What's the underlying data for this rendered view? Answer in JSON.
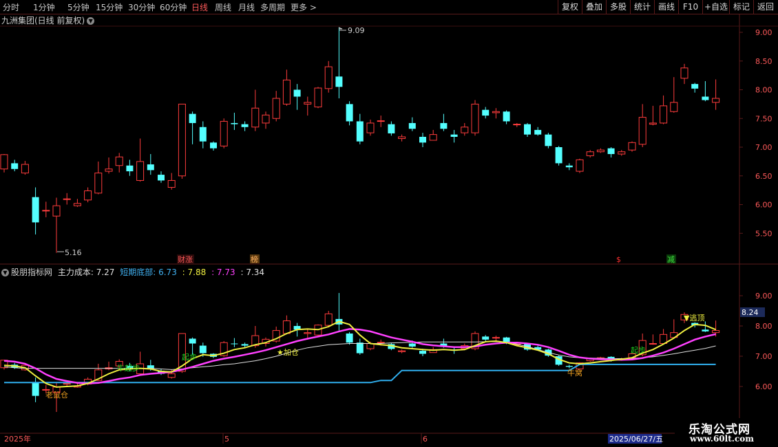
{
  "toolbar": {
    "periods": [
      "分时",
      "1分钟",
      "5分钟",
      "15分钟",
      "30分钟",
      "60分钟",
      "日线",
      "周线",
      "月线",
      "多周期",
      "更多 >"
    ],
    "active_period": "日线",
    "right_buttons": [
      "复权",
      "叠加",
      "多股",
      "统计",
      "画线",
      "F10",
      "+自选",
      "标记",
      "返回"
    ]
  },
  "main_chart": {
    "title": "九洲集团(日线 前复权)",
    "price_ticks": [
      "9.00",
      "8.50",
      "8.00",
      "7.50",
      "7.00",
      "6.50",
      "6.00",
      "5.50"
    ],
    "high_label": "9.09",
    "low_label": "5.16",
    "event_markers": [
      {
        "label": "财涨",
        "color": "#ff5a5a"
      },
      {
        "label": "榜",
        "color": "#ffb060"
      },
      {
        "label": "$",
        "color": "#ff3030"
      },
      {
        "label": "减",
        "color": "#40e040"
      }
    ]
  },
  "indicator": {
    "source": "股朋指标网",
    "items": [
      {
        "label": "主力成本: 7.27",
        "color": "#e0e0e0"
      },
      {
        "label": "短期底部: 6.73",
        "color": "#40b0f0"
      },
      {
        "label": ": 7.88",
        "color": "#f0f040"
      },
      {
        "label": ": 7.73",
        "color": "#ff40ff"
      },
      {
        "label": ": 7.34",
        "color": "#e0e0e0"
      }
    ],
    "ticks": [
      "9.00",
      "8.00",
      "7.00",
      "6.00"
    ],
    "current_value": "8.24",
    "signals": [
      "老鼠仓",
      "牛起步",
      "起步",
      "★加仓",
      "牛窝",
      "起步",
      "▼逃顶"
    ]
  },
  "date_axis": {
    "labels": [
      "2025年",
      "5",
      "6"
    ],
    "current_date": "2025/06/27/五"
  },
  "watermark": {
    "name": "乐淘公式网",
    "url": "www.60lt.com"
  },
  "colors": {
    "up": "#ff3c3c",
    "down": "#54ffff",
    "yellow": "#f0f040",
    "magenta": "#ff40ff",
    "blue": "#30b0f0",
    "white": "#e0e0e0",
    "grid": "#5a1a1a"
  },
  "candles": [
    [
      6.62,
      6.87,
      6.56,
      6.88
    ],
    [
      6.72,
      6.62,
      6.58,
      6.78
    ],
    [
      6.55,
      6.7,
      6.52,
      6.76
    ],
    [
      6.13,
      5.69,
      5.48,
      6.3
    ],
    [
      5.9,
      5.9,
      5.78,
      6.05
    ],
    [
      5.8,
      5.98,
      5.16,
      6.12
    ],
    [
      6.1,
      6.1,
      6.0,
      6.2
    ],
    [
      5.98,
      6.02,
      5.96,
      6.1
    ],
    [
      6.08,
      6.24,
      6.04,
      6.3
    ],
    [
      6.2,
      6.55,
      6.18,
      6.75
    ],
    [
      6.58,
      6.62,
      6.54,
      6.82
    ],
    [
      6.68,
      6.83,
      6.56,
      6.9
    ],
    [
      6.68,
      6.58,
      6.5,
      6.78
    ],
    [
      6.42,
      6.75,
      6.4,
      7.15
    ],
    [
      6.7,
      6.6,
      6.52,
      6.88
    ],
    [
      6.52,
      6.42,
      6.38,
      6.58
    ],
    [
      6.3,
      6.42,
      6.26,
      6.55
    ],
    [
      6.5,
      7.75,
      6.45,
      7.75
    ],
    [
      7.58,
      7.42,
      7.05,
      7.62
    ],
    [
      7.35,
      7.1,
      6.98,
      7.45
    ],
    [
      7.08,
      6.98,
      6.94,
      7.1
    ],
    [
      7.02,
      7.45,
      6.98,
      7.5
    ],
    [
      7.42,
      7.4,
      7.3,
      7.6
    ],
    [
      7.4,
      7.35,
      7.28,
      7.45
    ],
    [
      7.35,
      7.68,
      7.28,
      8.0
    ],
    [
      7.42,
      7.56,
      7.32,
      7.62
    ],
    [
      7.5,
      7.85,
      7.45,
      7.98
    ],
    [
      7.75,
      8.17,
      7.72,
      8.35
    ],
    [
      8.0,
      7.88,
      7.65,
      8.1
    ],
    [
      7.75,
      7.78,
      7.55,
      7.88
    ],
    [
      7.7,
      8.03,
      7.68,
      8.05
    ],
    [
      8.02,
      8.4,
      7.95,
      8.5
    ],
    [
      8.23,
      8.05,
      7.85,
      9.09
    ],
    [
      7.75,
      7.45,
      7.38,
      7.8
    ],
    [
      7.45,
      7.1,
      7.05,
      7.58
    ],
    [
      7.25,
      7.42,
      7.2,
      7.48
    ],
    [
      7.45,
      7.46,
      7.35,
      7.55
    ],
    [
      7.4,
      7.24,
      7.2,
      7.45
    ],
    [
      7.15,
      7.18,
      7.1,
      7.22
    ],
    [
      7.42,
      7.32,
      7.28,
      7.52
    ],
    [
      7.18,
      7.08,
      7.0,
      7.25
    ],
    [
      7.12,
      7.22,
      7.15,
      7.3
    ],
    [
      7.42,
      7.32,
      7.28,
      7.58
    ],
    [
      7.22,
      7.18,
      7.08,
      7.3
    ],
    [
      7.25,
      7.35,
      7.2,
      7.42
    ],
    [
      7.25,
      7.75,
      7.2,
      7.82
    ],
    [
      7.65,
      7.55,
      7.5,
      7.7
    ],
    [
      7.6,
      7.62,
      7.5,
      7.68
    ],
    [
      7.62,
      7.45,
      7.4,
      7.64
    ],
    [
      7.4,
      7.4,
      7.35,
      7.42
    ],
    [
      7.4,
      7.22,
      7.18,
      7.42
    ],
    [
      7.3,
      7.22,
      7.2,
      7.35
    ],
    [
      7.22,
      7.02,
      6.98,
      7.25
    ],
    [
      7.0,
      6.72,
      6.68,
      7.02
    ],
    [
      6.68,
      6.65,
      6.6,
      6.72
    ],
    [
      6.58,
      6.78,
      6.55,
      6.8
    ],
    [
      6.85,
      6.92,
      6.82,
      6.95
    ],
    [
      6.92,
      6.95,
      6.9,
      6.98
    ],
    [
      6.98,
      6.88,
      6.82,
      7.0
    ],
    [
      6.88,
      6.92,
      6.85,
      6.95
    ],
    [
      6.95,
      7.08,
      6.92,
      7.1
    ],
    [
      7.05,
      7.52,
      7.0,
      7.75
    ],
    [
      7.4,
      7.42,
      7.38,
      7.72
    ],
    [
      7.42,
      7.72,
      7.4,
      7.9
    ],
    [
      7.62,
      7.78,
      7.6,
      8.22
    ],
    [
      8.2,
      8.38,
      8.1,
      8.45
    ],
    [
      8.1,
      8.02,
      7.95,
      8.12
    ],
    [
      7.88,
      7.82,
      7.8,
      8.15
    ],
    [
      7.78,
      7.85,
      7.65,
      8.18
    ]
  ],
  "indicator_lines": {
    "main_cost": [
      6.65,
      6.62,
      6.6,
      6.6,
      6.6,
      6.6,
      6.6,
      6.6,
      6.6,
      6.6,
      6.6,
      6.6,
      6.6,
      6.6,
      6.6,
      6.58,
      6.56,
      6.58,
      6.62,
      6.65,
      6.68,
      6.72,
      6.75,
      6.8,
      6.85,
      6.92,
      7.0,
      7.1,
      7.2,
      7.28,
      7.33,
      7.38,
      7.4,
      7.42,
      7.42,
      7.42,
      7.42,
      7.44,
      7.45,
      7.46,
      7.47,
      7.47,
      7.47,
      7.47,
      7.47,
      7.47,
      7.48,
      7.48,
      7.46,
      7.4,
      7.32,
      7.22,
      7.12,
      7.04,
      6.98,
      6.95,
      6.94,
      6.93,
      6.92,
      6.92,
      6.93,
      6.95,
      6.98,
      7.03,
      7.08,
      7.14,
      7.2,
      7.26,
      7.34
    ],
    "bottom": [
      6.13,
      6.13,
      6.13,
      6.13,
      6.13,
      6.13,
      6.13,
      6.13,
      6.13,
      6.13,
      6.13,
      6.13,
      6.13,
      6.13,
      6.13,
      6.13,
      6.13,
      6.13,
      6.13,
      6.13,
      6.13,
      6.13,
      6.13,
      6.13,
      6.13,
      6.13,
      6.13,
      6.13,
      6.13,
      6.13,
      6.13,
      6.13,
      6.13,
      6.13,
      6.13,
      6.13,
      6.2,
      6.2,
      6.53,
      6.53,
      6.53,
      6.53,
      6.53,
      6.53,
      6.53,
      6.53,
      6.53,
      6.53,
      6.53,
      6.53,
      6.53,
      6.53,
      6.53,
      6.53,
      6.53,
      6.73,
      6.73,
      6.73,
      6.73,
      6.73,
      6.73,
      6.73,
      6.73,
      6.73,
      6.73,
      6.73,
      6.73,
      6.73,
      6.73
    ],
    "fast": [
      6.7,
      6.68,
      6.62,
      6.35,
      6.1,
      5.98,
      6.0,
      6.02,
      6.1,
      6.25,
      6.42,
      6.55,
      6.58,
      6.6,
      6.58,
      6.5,
      6.48,
      6.68,
      6.92,
      7.05,
      7.02,
      7.1,
      7.22,
      7.28,
      7.38,
      7.45,
      7.58,
      7.75,
      7.88,
      7.9,
      7.88,
      7.98,
      8.15,
      8.05,
      7.7,
      7.42,
      7.38,
      7.35,
      7.28,
      7.25,
      7.22,
      7.2,
      7.22,
      7.2,
      7.22,
      7.35,
      7.48,
      7.5,
      7.45,
      7.35,
      7.28,
      7.2,
      7.08,
      6.9,
      6.78,
      6.75,
      6.78,
      6.82,
      6.86,
      6.9,
      6.95,
      7.1,
      7.22,
      7.4,
      7.6,
      7.85,
      8.05,
      8.02,
      7.88
    ],
    "slow": [
      6.85,
      6.82,
      6.75,
      6.6,
      6.4,
      6.25,
      6.18,
      6.12,
      6.1,
      6.12,
      6.18,
      6.25,
      6.3,
      6.38,
      6.42,
      6.45,
      6.48,
      6.56,
      6.65,
      6.75,
      6.85,
      6.92,
      6.98,
      7.05,
      7.12,
      7.2,
      7.3,
      7.4,
      7.5,
      7.58,
      7.65,
      7.72,
      7.82,
      7.9,
      7.88,
      7.82,
      7.72,
      7.62,
      7.55,
      7.48,
      7.4,
      7.36,
      7.33,
      7.3,
      7.3,
      7.32,
      7.38,
      7.42,
      7.45,
      7.45,
      7.42,
      7.38,
      7.3,
      7.18,
      7.05,
      6.96,
      6.92,
      6.9,
      6.89,
      6.88,
      6.89,
      6.94,
      7.02,
      7.12,
      7.25,
      7.4,
      7.55,
      7.65,
      7.73
    ]
  }
}
